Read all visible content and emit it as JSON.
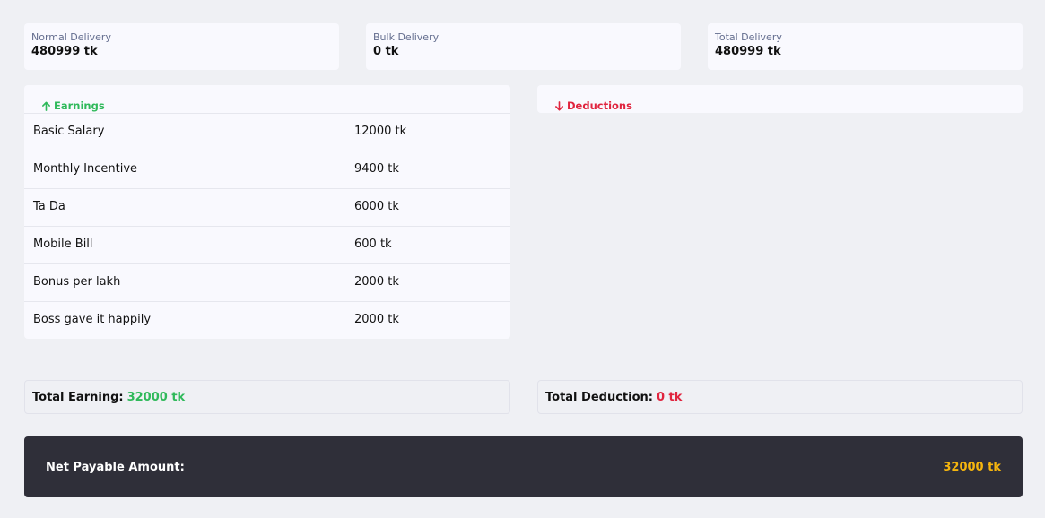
{
  "stats": [
    {
      "label": "Normal Delivery",
      "value": "480999 tk"
    },
    {
      "label": "Bulk Delivery",
      "value": "0 tk"
    },
    {
      "label": "Total Delivery",
      "value": "480999 tk"
    }
  ],
  "earnings": {
    "title": "Earnings",
    "icon": "arrow-up-icon",
    "color": "#2fb95a",
    "items": [
      {
        "name": "Basic Salary",
        "amount": "12000 tk"
      },
      {
        "name": "Monthly Incentive",
        "amount": "9400 tk"
      },
      {
        "name": "Ta Da",
        "amount": "6000 tk"
      },
      {
        "name": "Mobile Bill",
        "amount": "600 tk"
      },
      {
        "name": "Bonus per lakh",
        "amount": "2000 tk"
      },
      {
        "name": "Boss gave it happily",
        "amount": "2000 tk"
      }
    ]
  },
  "deductions": {
    "title": "Deductions",
    "icon": "arrow-down-icon",
    "color": "#e0243e",
    "items": []
  },
  "totals": {
    "earning_label": "Total Earning:",
    "earning_value": "32000 tk",
    "deduction_label": "Total Deduction:",
    "deduction_value": "0 tk"
  },
  "net": {
    "label": "Net Payable Amount:",
    "value": "32000 tk",
    "value_color": "#f5b50e"
  }
}
